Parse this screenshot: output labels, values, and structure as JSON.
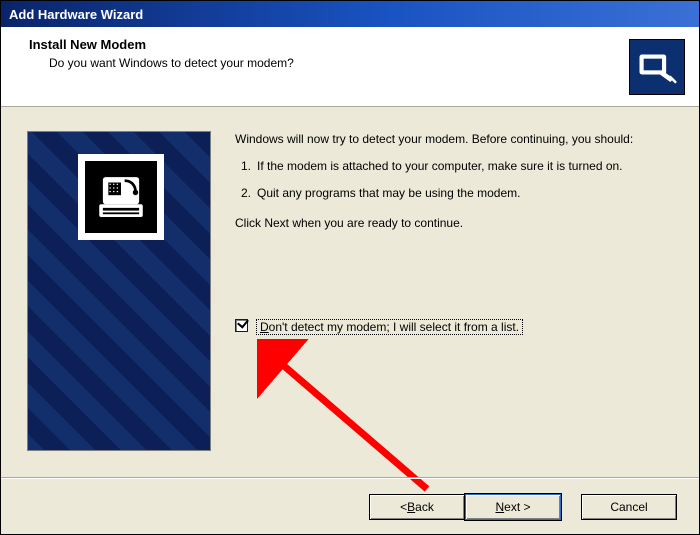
{
  "titlebar": {
    "title": "Add Hardware Wizard"
  },
  "header": {
    "title": "Install New Modem",
    "subtitle": "Do you want Windows to detect your modem?"
  },
  "main": {
    "intro": "Windows will now try to detect your modem.  Before continuing, you should:",
    "steps": [
      "If the modem is attached to your computer, make sure it is turned on.",
      "Quit any programs that may be using the modem."
    ],
    "continue": "Click Next when you are ready to continue.",
    "checkbox": {
      "checked": true,
      "prefix": "D",
      "rest": "on't detect my modem; I will select it from a list."
    }
  },
  "buttons": {
    "back_sym": "< ",
    "back_u": "B",
    "back_rest": "ack",
    "next_u": "N",
    "next_rest": "ext >",
    "cancel": "Cancel"
  },
  "icons": {
    "modem": "modem-icon",
    "detect": "detect-card-icon"
  }
}
